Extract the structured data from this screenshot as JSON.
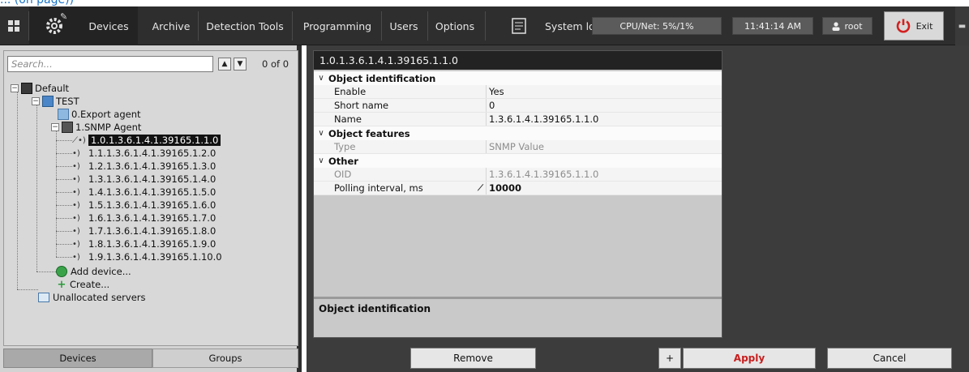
{
  "page_top_link": "... (on page))",
  "topbar": {
    "devices": "Devices",
    "archive": "Archive",
    "detection_tools": "Detection Tools",
    "programming": "Programming",
    "users": "Users",
    "options": "Options",
    "system_log": "System log",
    "cpu_net": "CPU/Net: 5%/1%",
    "time": "11:41:14 AM",
    "user": "root",
    "exit": "Exit"
  },
  "search": {
    "placeholder": "Search...",
    "count": "0 of 0"
  },
  "tree": {
    "default": "Default",
    "test": "TEST",
    "export_agent": "0.Export agent",
    "snmp_agent": "1.SNMP Agent",
    "values": [
      "1.0.1.3.6.1.4.1.39165.1.1.0",
      "1.1.1.3.6.1.4.1.39165.1.2.0",
      "1.2.1.3.6.1.4.1.39165.1.3.0",
      "1.3.1.3.6.1.4.1.39165.1.4.0",
      "1.4.1.3.6.1.4.1.39165.1.5.0",
      "1.5.1.3.6.1.4.1.39165.1.6.0",
      "1.6.1.3.6.1.4.1.39165.1.7.0",
      "1.7.1.3.6.1.4.1.39165.1.8.0",
      "1.8.1.3.6.1.4.1.39165.1.9.0",
      "1.9.1.3.6.1.4.1.39165.1.10.0"
    ],
    "add_device": "Add device...",
    "create": "Create...",
    "unallocated": "Unallocated servers"
  },
  "left_tabs": {
    "devices": "Devices",
    "groups": "Groups"
  },
  "properties": {
    "header": "1.0.1.3.6.1.4.1.39165.1.1.0",
    "object_identification": "Object identification",
    "enable_label": "Enable",
    "enable_value": "Yes",
    "short_name_label": "Short name",
    "short_name_value": "0",
    "name_label": "Name",
    "name_value": "1.3.6.1.4.1.39165.1.1.0",
    "object_features": "Object features",
    "type_label": "Type",
    "type_value": "SNMP Value",
    "other": "Other",
    "oid_label": "OID",
    "oid_value": "1.3.6.1.4.1.39165.1.1.0",
    "polling_label": "Polling interval, ms",
    "polling_value": "10000",
    "description_title": "Object identification"
  },
  "buttons": {
    "remove": "Remove",
    "plus": "+",
    "apply": "Apply",
    "cancel": "Cancel"
  },
  "colors": {
    "topbar_bg": "#2e2e2e",
    "selected_tree_bg": "#111111",
    "apply_text": "#c81e1e"
  }
}
